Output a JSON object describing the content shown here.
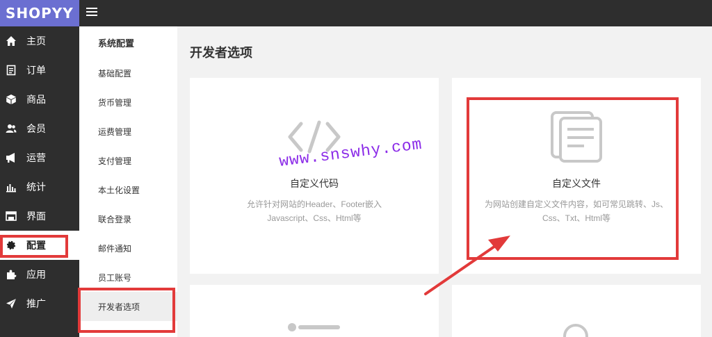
{
  "app": {
    "logo_text": "SHOPYY"
  },
  "sidebar": {
    "items": [
      {
        "label": "主页",
        "icon": "home-icon"
      },
      {
        "label": "订单",
        "icon": "order-icon"
      },
      {
        "label": "商品",
        "icon": "box-icon"
      },
      {
        "label": "会员",
        "icon": "members-icon"
      },
      {
        "label": "运营",
        "icon": "megaphone-icon"
      },
      {
        "label": "统计",
        "icon": "chart-icon"
      },
      {
        "label": "界面",
        "icon": "layout-icon"
      },
      {
        "label": "配置",
        "icon": "gear-icon",
        "active": true
      },
      {
        "label": "应用",
        "icon": "puzzle-icon"
      },
      {
        "label": "推广",
        "icon": "send-icon"
      }
    ]
  },
  "subnav": {
    "title": "系统配置",
    "items": [
      "基础配置",
      "货币管理",
      "运费管理",
      "支付管理",
      "本土化设置",
      "联合登录",
      "邮件通知",
      "员工账号",
      "开发者选项"
    ],
    "active_index": 8
  },
  "main": {
    "title": "开发者选项",
    "cards": [
      {
        "title": "自定义代码",
        "desc_line1": "允许针对网站的Header、Footer嵌入",
        "desc_line2": "Javascript、Css、Html等",
        "icon": "code-icon"
      },
      {
        "title": "自定义文件",
        "desc_line1": "为网站创建自定义文件内容，如可常见跳转、Js、",
        "desc_line2": "Css、Txt、Html等",
        "icon": "file-icon"
      }
    ]
  },
  "watermark": "www.snswhy.com",
  "colors": {
    "accent": "#6b6fd1",
    "dark": "#2e2e2e",
    "highlight": "#e23a3a",
    "watermark": "#8b2be8"
  }
}
